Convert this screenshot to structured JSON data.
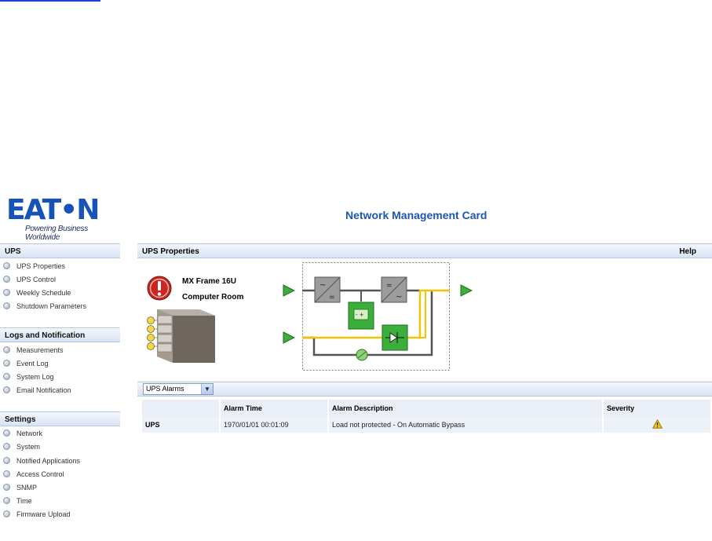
{
  "header": {
    "logo_text": "EAT•N",
    "logo_tagline": "Powering Business Worldwide",
    "app_title": "Network Management Card"
  },
  "sidebar": {
    "sections": [
      {
        "title": "UPS",
        "items": [
          "UPS Properties",
          "UPS Control",
          "Weekly Schedule",
          "Shutdown Parameters"
        ]
      },
      {
        "title": "Logs and Notification",
        "items": [
          "Measurements",
          "Event Log",
          "System Log",
          "Email Notification"
        ]
      },
      {
        "title": "Settings",
        "items": [
          "Network",
          "System",
          "Notified Applications",
          "Access Control",
          "SNMP",
          "Time",
          "Firmware Upload"
        ]
      }
    ]
  },
  "main": {
    "panel_title": "UPS Properties",
    "help_label": "Help",
    "ups": {
      "name": "MX Frame 16U",
      "location": "Computer Room"
    },
    "alarm_filter": {
      "selected": "UPS Alarms"
    },
    "alarm_table": {
      "columns": [
        "",
        "Alarm Time",
        "Alarm Description",
        "Severity"
      ],
      "rows": [
        {
          "source": "UPS",
          "time": "1970/01/01 00:01:09",
          "description": "Load not protected - On Automatic Bypass",
          "severity_icon": "warning-triangle-icon"
        }
      ]
    }
  },
  "colors": {
    "brand_blue": "#1553b8",
    "title_blue": "#1d55b6",
    "power_path_yellow": "#f5c400",
    "green": "#3cae3c",
    "alarm_red": "#c8261e",
    "warning_yellow": "#f1c40f"
  }
}
